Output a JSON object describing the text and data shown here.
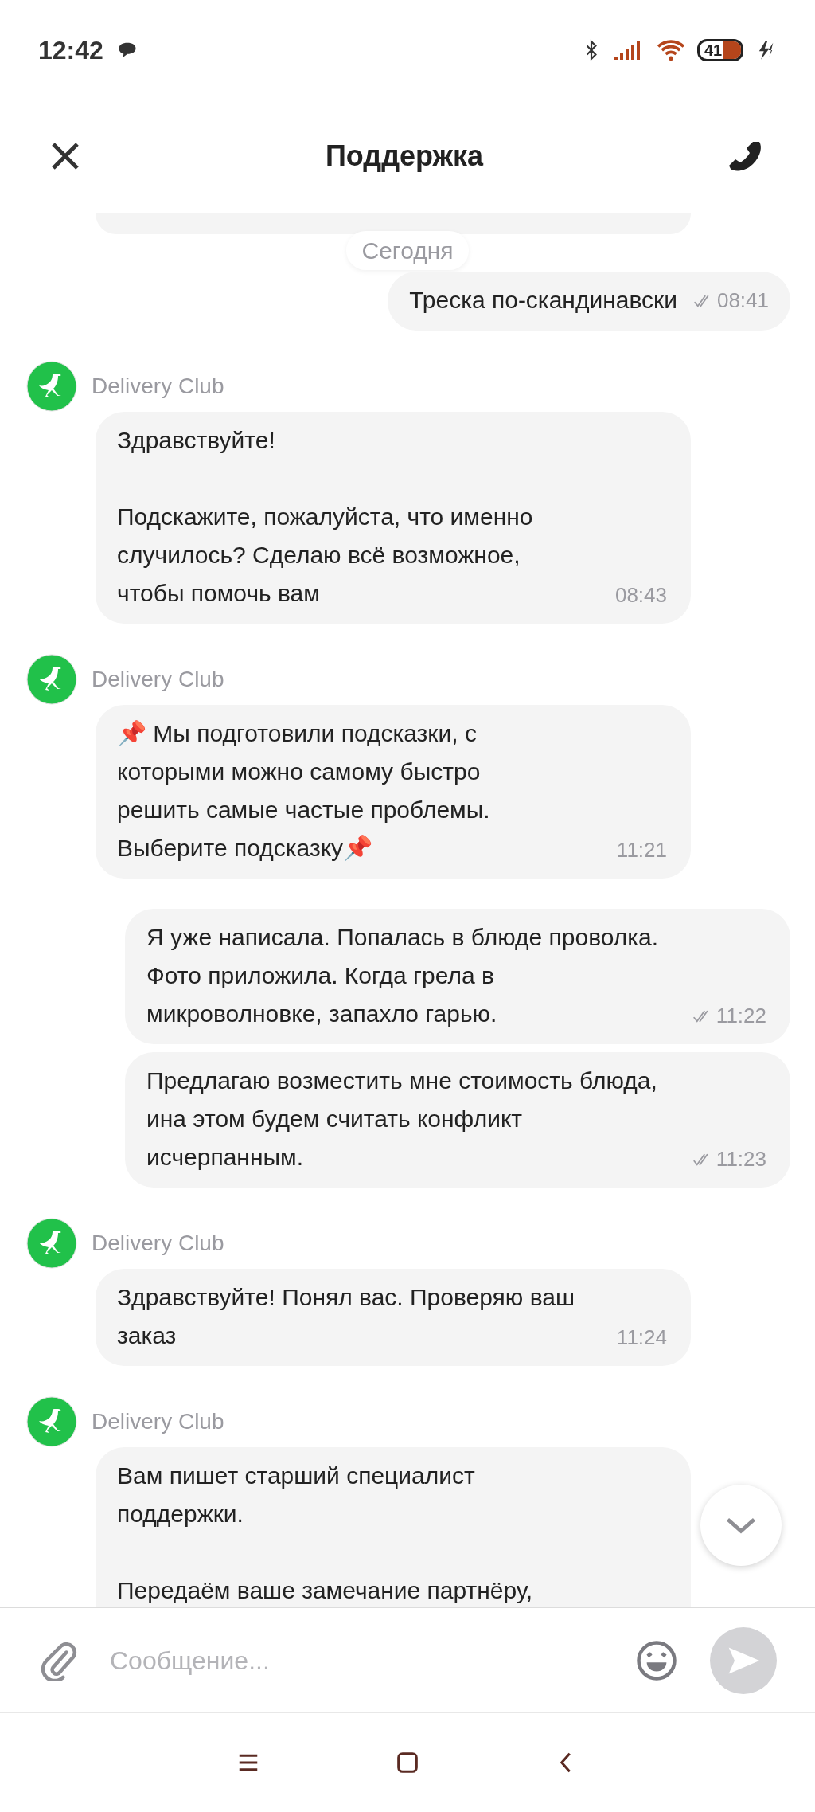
{
  "status_bar": {
    "time": "12:42",
    "battery": "41"
  },
  "header": {
    "title": "Поддержка"
  },
  "date_divider": "Сегодня",
  "messages": [
    {
      "kind": "outgoing",
      "text": "Треска по-скандинавски",
      "time": "08:41",
      "read": true
    },
    {
      "kind": "incoming",
      "sender": "Delivery Club",
      "text": "Здравствуйте!\n\nПодскажите, пожалуйста, что именно\nслучилось? Сделаю всё возможное,\nчтобы помочь вам",
      "time": "08:43"
    },
    {
      "kind": "incoming",
      "sender": "Delivery Club",
      "text": "📌 Мы подготовили подсказки, с\nкоторыми можно самому быстро\nрешить самые частые проблемы.\nВыберите подсказку📌",
      "time": "11:21"
    },
    {
      "kind": "outgoing",
      "text": "Я уже написала. Попалась в блюде проволка.\nФото приложила. Когда грела в\nмикроволновке, запахло гарью.",
      "time": "11:22",
      "read": true
    },
    {
      "kind": "outgoing",
      "text": "Предлагаю возместить мне стоимость блюда,\nина этом будем считать конфликт\nисчерпанным.",
      "time": "11:23",
      "read": true
    },
    {
      "kind": "incoming",
      "sender": "Delivery Club",
      "text": "Здравствуйте! Понял вас. Проверяю ваш\nзаказ",
      "time": "11:24"
    },
    {
      "kind": "incoming",
      "sender": "Delivery Club",
      "text": "Вам пишет старший специалист\nподдержки.\n\nПередаём ваше замечание партнёру,"
    }
  ],
  "composer": {
    "placeholder": "Сообщение..."
  }
}
